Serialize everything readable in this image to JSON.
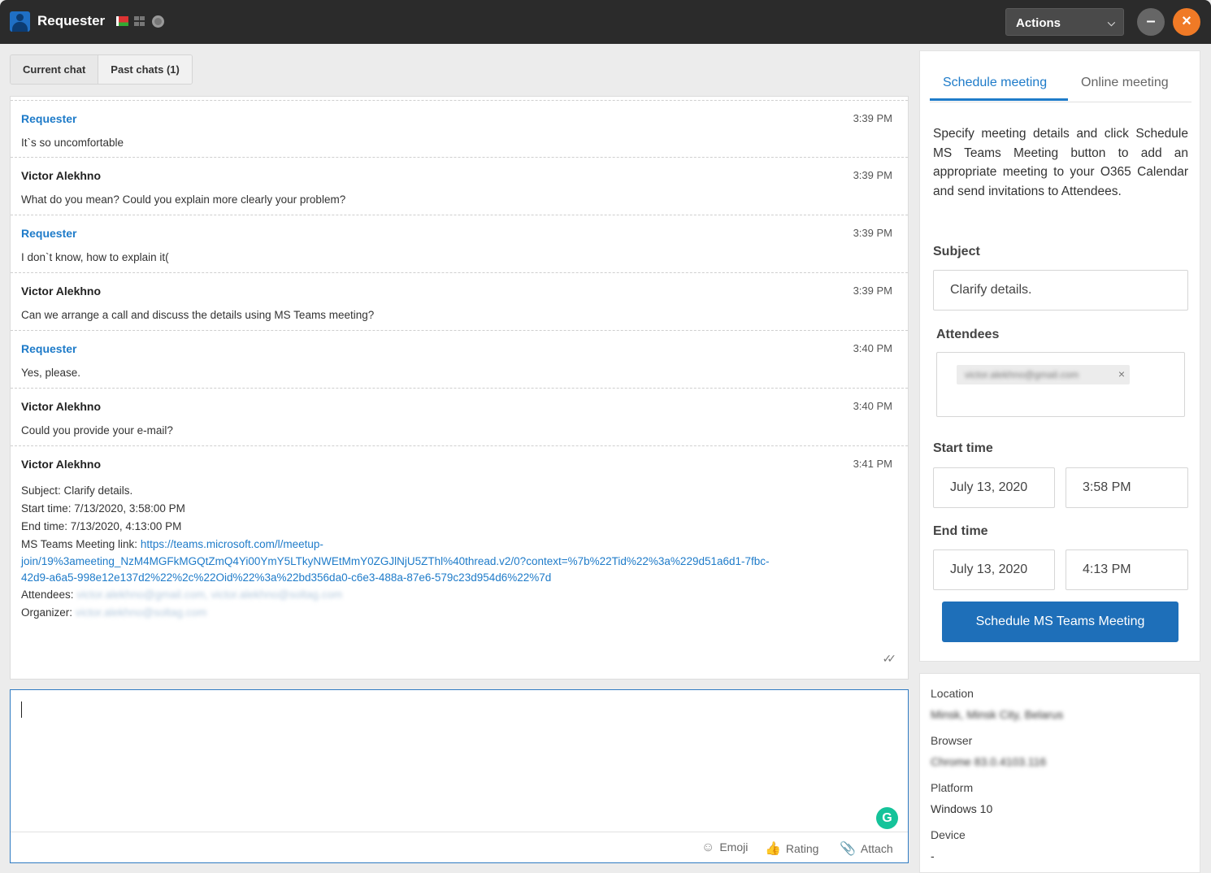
{
  "window": {
    "title": "Requester",
    "actions_label": "Actions"
  },
  "tabs": {
    "current": "Current chat",
    "past": "Past chats (1)"
  },
  "messages": [
    {
      "author": "Requester",
      "time": "3:39 PM",
      "text": "It`s so uncomfortable"
    },
    {
      "author": "Victor Alekhno",
      "time": "3:39 PM",
      "text": "What do you mean? Could you explain more clearly your problem?"
    },
    {
      "author": "Requester",
      "time": "3:39 PM",
      "text": "I don`t know, how to explain it("
    },
    {
      "author": "Victor Alekhno",
      "time": "3:39 PM",
      "text": "Can we arrange a call and discuss the details using MS Teams meeting?"
    },
    {
      "author": "Requester",
      "time": "3:40 PM",
      "text": "Yes, please."
    },
    {
      "author": "Victor Alekhno",
      "time": "3:40 PM",
      "text": "Could you provide your e-mail?"
    }
  ],
  "meeting_message": {
    "author": "Victor Alekhno",
    "time": "3:41 PM",
    "subject": "Subject: Clarify details.",
    "start": "Start time: 7/13/2020, 3:58:00 PM",
    "end": "End time: 7/13/2020, 4:13:00 PM",
    "link_label": "MS Teams Meeting link: ",
    "link_line1": "https://teams.microsoft.com/l/meetup-",
    "link_line2": "join/19%3ameeting_NzM4MGFkMGQtZmQ4Yi00YmY5LTkyNWEtMmY0ZGJlNjU5ZThl%40thread.v2/0?context=%7b%22Tid%22%3a%229d51a6d1-7fbc-",
    "link_line3": "42d9-a6a5-998e12e137d2%22%2c%22Oid%22%3a%22bd356da0-c6e3-488a-87e6-579c23d954d6%22%7d",
    "attendees_label": "Attendees: ",
    "attendees_value": "victor.alekhno@gmail.com, victor.alekhno@soltag.com",
    "organizer_label": "Organizer: ",
    "organizer_value": "victor.alekhno@soltag.com"
  },
  "compose": {
    "emoji": "Emoji",
    "rating": "Rating",
    "attach": "Attach"
  },
  "meeting_panel": {
    "tab_schedule": "Schedule meeting",
    "tab_online": "Online meeting",
    "description": "Specify meeting details and click Schedule MS Teams Meeting button to add an appropriate meeting to your O365 Calendar and send invitations to Attendees.",
    "subject_label": "Subject",
    "subject_value": "Clarify details.",
    "attendees_label": "Attendees",
    "attendee_chip": "victor.alekhno@gmail.com",
    "start_label": "Start time",
    "start_date": "July 13, 2020",
    "start_time": "3:58 PM",
    "end_label": "End time",
    "end_date": "July 13, 2020",
    "end_time": "4:13 PM",
    "schedule_button": "Schedule MS Teams Meeting"
  },
  "info": {
    "location_label": "Location",
    "location_value": "Minsk, Minsk City, Belarus",
    "browser_label": "Browser",
    "browser_value": "Chrome 83.0.4103.116",
    "platform_label": "Platform",
    "platform_value": "Windows 10",
    "device_label": "Device",
    "device_value": "-"
  },
  "colors": {
    "accent": "#1e7bc9",
    "titlebar": "#2b2b2b",
    "close": "#f07a26"
  }
}
